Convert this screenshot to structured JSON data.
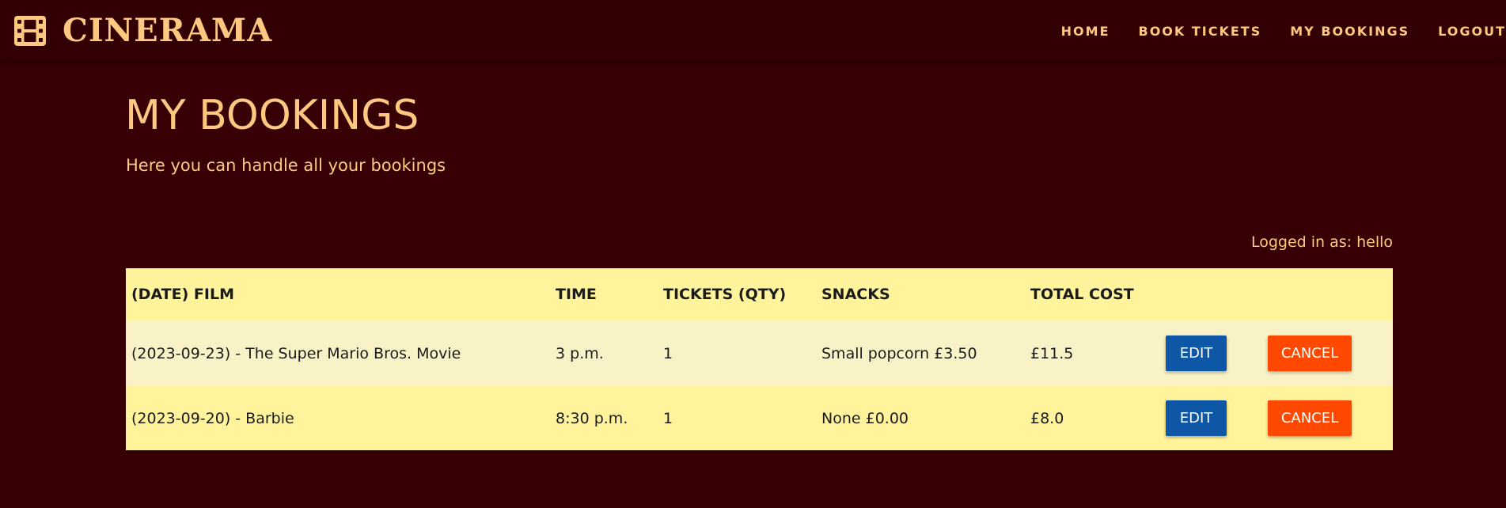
{
  "brand": {
    "name": "CINERAMA",
    "icon": "film-icon"
  },
  "nav": {
    "items": [
      {
        "label": "HOME"
      },
      {
        "label": "BOOK TICKETS"
      },
      {
        "label": "MY BOOKINGS"
      },
      {
        "label": "LOGOUT"
      }
    ]
  },
  "page": {
    "title": "MY BOOKINGS",
    "subtitle": "Here you can handle all your bookings",
    "logged_in": "Logged in as: hello"
  },
  "table": {
    "headers": [
      "(DATE) FILM",
      "TIME",
      "TICKETS (QTY)",
      "SNACKS",
      "TOTAL COST"
    ],
    "rows": [
      {
        "film": "(2023-09-23) - The Super Mario Bros. Movie",
        "time": "3 p.m.",
        "tickets": "1",
        "snacks": "Small popcorn £3.50",
        "total": "£11.5",
        "edit_label": "EDIT",
        "cancel_label": "CANCEL"
      },
      {
        "film": "(2023-09-20) - Barbie",
        "time": "8:30 p.m.",
        "tickets": "1",
        "snacks": "None £0.00",
        "total": "£8.0",
        "edit_label": "EDIT",
        "cancel_label": "CANCEL"
      }
    ]
  },
  "colors": {
    "background": "#360004",
    "accent": "#ffc880",
    "table_header": "#fff49c",
    "row_light": "#f9f2c6",
    "edit_button": "#0d57a6",
    "cancel_button": "#ff4800"
  }
}
